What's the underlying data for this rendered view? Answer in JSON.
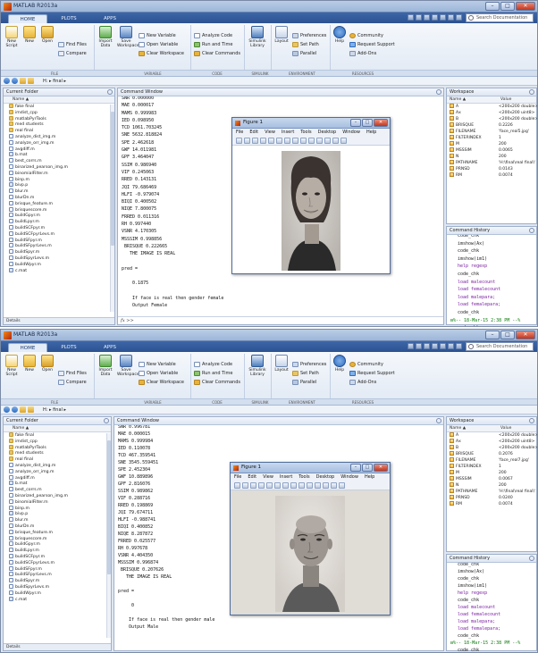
{
  "top": {
    "app_title": "MATLAB R2013a",
    "tabs": [
      "HOME",
      "PLOTS",
      "APPS"
    ],
    "search_placeholder": "Search Documentation",
    "ribbon": {
      "new_script": "New Script",
      "new": "New",
      "open": "Open",
      "find_files": "Find Files",
      "compare": "Compare",
      "import_data": "Import Data",
      "save_workspace": "Save Workspace",
      "new_variable": "New Variable",
      "open_variable": "Open Variable",
      "clear_workspace": "Clear Workspace",
      "analyze_code": "Analyze Code",
      "run_and_time": "Run and Time",
      "clear_commands": "Clear Commands",
      "simulink_library": "Simulink Library",
      "layout": "Layout",
      "preferences": "Preferences",
      "set_path": "Set Path",
      "parallel": "Parallel",
      "help": "Help",
      "community": "Community",
      "request_support": "Request Support",
      "add_ons": "Add-Ons",
      "groups": [
        "FILE",
        "VARIABLE",
        "CODE",
        "SIMULINK",
        "ENVIRONMENT",
        "RESOURCES"
      ]
    },
    "path": "H: ▸ final ▸",
    "current_folder_title": "Current Folder",
    "name_col": "Name ▲",
    "files": [
      {
        "name": "fake final",
        "type": "folder"
      },
      {
        "name": "imdist_cpp",
        "type": "folder"
      },
      {
        "name": "matlabPyrTools",
        "type": "folder"
      },
      {
        "name": "med students",
        "type": "folder"
      },
      {
        "name": "real final",
        "type": "folder"
      },
      {
        "name": "analyze_dist_img.m",
        "type": "m"
      },
      {
        "name": "analyze_orr_img.m",
        "type": "m"
      },
      {
        "name": "avgdiff.m",
        "type": "m"
      },
      {
        "name": "b.mat",
        "type": "c"
      },
      {
        "name": "best_corrs.m",
        "type": "m"
      },
      {
        "name": "binarized_pearson_img.m",
        "type": "m"
      },
      {
        "name": "binomialFilter.m",
        "type": "m"
      },
      {
        "name": "binp.m",
        "type": "m"
      },
      {
        "name": "bivp.p",
        "type": "c"
      },
      {
        "name": "blur.m",
        "type": "m"
      },
      {
        "name": "blurDn.m",
        "type": "m"
      },
      {
        "name": "brisque_feature.m",
        "type": "m"
      },
      {
        "name": "brisquescore.m",
        "type": "m"
      },
      {
        "name": "buildGpyr.m",
        "type": "m"
      },
      {
        "name": "buildLpyr.m",
        "type": "m"
      },
      {
        "name": "buildSCFpyr.m",
        "type": "m"
      },
      {
        "name": "buildSCFpyrLevs.m",
        "type": "m"
      },
      {
        "name": "buildSFpyr.m",
        "type": "m"
      },
      {
        "name": "buildSFpyrLevs.m",
        "type": "m"
      },
      {
        "name": "buildSpyr.m",
        "type": "m"
      },
      {
        "name": "buildSpyrLevs.m",
        "type": "m"
      },
      {
        "name": "buildWpyr.m",
        "type": "m"
      },
      {
        "name": "c.mat",
        "type": "c"
      }
    ],
    "details": "Details",
    "command_window_title": "Command Window",
    "command_lines": [
      "SNR 0.000000",
      "MAE 0.000017",
      "MAMS 0.999983",
      "IED 0.098950",
      "TCD 1061.703245",
      "SNE 5632.818824",
      "SPE 2.462618",
      "GWF 14.011981",
      "GPF 3.464047",
      "SSIM 0.986940",
      "VIF 0.245063",
      "RRED 0.143131",
      "JQI 79.686469",
      "HLFI -0.979074",
      "BIQI 0.400502",
      "NIQE 7.800075",
      "FRRED 0.011316",
      "RH 0.997440",
      "VSNR 4.170305",
      "MSSSIM 0.998856",
      " BRISQUE 0.222665",
      "   THE IMAGE IS REAL",
      "",
      "pred =",
      "",
      "    0.1875",
      "",
      "    If face is real then gender female",
      "    Output Female"
    ],
    "prompt": "fx >>",
    "figure_title": "Figure 1",
    "figure_menu": [
      "File",
      "Edit",
      "View",
      "Insert",
      "Tools",
      "Desktop",
      "Window",
      "Help"
    ],
    "workspace_title": "Workspace",
    "ws_cols": [
      "Name ▲",
      "Value"
    ],
    "workspace": [
      {
        "name": "A",
        "value": "<200x200 double>"
      },
      {
        "name": "Ax",
        "value": "<200x200 uint8>"
      },
      {
        "name": "B",
        "value": "<200x200 double>"
      },
      {
        "name": "BRISQUE",
        "value": "0.2226"
      },
      {
        "name": "FILENAME",
        "value": "'face_real5.jpg'"
      },
      {
        "name": "FILTERINDEX",
        "value": "1"
      },
      {
        "name": "M",
        "value": "200"
      },
      {
        "name": "MSSSIM",
        "value": "0.0065"
      },
      {
        "name": "N",
        "value": "200"
      },
      {
        "name": "PATHNAME",
        "value": "'H:\\final\\real final\\'"
      },
      {
        "name": "PRNSD",
        "value": "0.0143"
      },
      {
        "name": "RM",
        "value": "0.0074"
      }
    ],
    "history_title": "Command History",
    "history": [
      {
        "text": "code_chk",
        "kind": "cmd"
      },
      {
        "text": "imshow(Ax)",
        "kind": "cmd"
      },
      {
        "text": "code_chk",
        "kind": "cmd"
      },
      {
        "text": "imshow(im1)",
        "kind": "cmd"
      },
      {
        "text": "help regexp",
        "kind": "kw"
      },
      {
        "text": "code_chk",
        "kind": "cmd"
      },
      {
        "text": "load malecount",
        "kind": "kw"
      },
      {
        "text": "load femalecount",
        "kind": "kw"
      },
      {
        "text": "load malepara;",
        "kind": "kw"
      },
      {
        "text": "load femalepara;",
        "kind": "kw"
      },
      {
        "text": "code_chk",
        "kind": "cmd"
      },
      {
        "text": "⊟%-- 18-Mar-15 2:38 PM --%",
        "kind": "sep"
      },
      {
        "text": "code_chk",
        "kind": "cmd"
      }
    ]
  },
  "bottom": {
    "app_title": "MATLAB R2013a",
    "tabs": [
      "HOME",
      "PLOTS",
      "APPS"
    ],
    "search_placeholder": "Search Documentation",
    "path": "H: ▸ final ▸",
    "current_folder_title": "Current Folder",
    "name_col": "Name ▲",
    "files": [
      {
        "name": "fake final",
        "type": "folder"
      },
      {
        "name": "imdist_cpp",
        "type": "folder"
      },
      {
        "name": "matlabPyrTools",
        "type": "folder"
      },
      {
        "name": "med students",
        "type": "folder"
      },
      {
        "name": "real final",
        "type": "folder"
      },
      {
        "name": "analyze_dist_img.m",
        "type": "m"
      },
      {
        "name": "analyze_orr_img.m",
        "type": "m"
      },
      {
        "name": "avgdiff.m",
        "type": "m"
      },
      {
        "name": "b.mat",
        "type": "c"
      },
      {
        "name": "best_corrs.m",
        "type": "m"
      },
      {
        "name": "binarized_pearson_img.m",
        "type": "m"
      },
      {
        "name": "binomialFilter.m",
        "type": "m"
      },
      {
        "name": "binp.m",
        "type": "m"
      },
      {
        "name": "bivp.p",
        "type": "c"
      },
      {
        "name": "blur.m",
        "type": "m"
      },
      {
        "name": "blurDn.m",
        "type": "m"
      },
      {
        "name": "brisque_feature.m",
        "type": "m"
      },
      {
        "name": "brisquescore.m",
        "type": "m"
      },
      {
        "name": "buildGpyr.m",
        "type": "m"
      },
      {
        "name": "buildLpyr.m",
        "type": "m"
      },
      {
        "name": "buildSCFpyr.m",
        "type": "m"
      },
      {
        "name": "buildSCFpyrLevs.m",
        "type": "m"
      },
      {
        "name": "buildSFpyr.m",
        "type": "m"
      },
      {
        "name": "buildSFpyrLevs.m",
        "type": "m"
      },
      {
        "name": "buildSpyr.m",
        "type": "m"
      },
      {
        "name": "buildSpyrLevs.m",
        "type": "m"
      },
      {
        "name": "buildWpyr.m",
        "type": "m"
      },
      {
        "name": "c.mat",
        "type": "c"
      }
    ],
    "details": "Details",
    "command_window_title": "Command Window",
    "command_lines": [
      "SNR 0.996781",
      "MAE 0.000015",
      "MAMS 0.999984",
      "IED 0.110078",
      "TCD 467.359541",
      "SNE 3545.559451",
      "SPE 2.452304",
      "GWF 10.889896",
      "GPF 2.816076",
      "SSIM 0.989862",
      "VIF 0.288716",
      "RRED 0.198869",
      "JQI 79.674711",
      "HLFI -0.988741",
      "BIQI 0.400852",
      "NIQE 8.287872",
      "FRRED 0.025577",
      "RH 0.997678",
      "VSNR 4.404350",
      "MSSSIM 0.996874",
      " BRISQUE 0.207626",
      "   THE IMAGE IS REAL",
      "",
      "pred =",
      "",
      "     0",
      "",
      "    If face is real then gender male",
      "    Output Male"
    ],
    "figure_title": "Figure 1",
    "figure_menu": [
      "File",
      "Edit",
      "View",
      "Insert",
      "Tools",
      "Desktop",
      "Window",
      "Help"
    ],
    "workspace_title": "Workspace",
    "ws_cols": [
      "Name ▲",
      "Value"
    ],
    "workspace": [
      {
        "name": "A",
        "value": "<200x200 double>"
      },
      {
        "name": "Ax",
        "value": "<200x200 uint8>"
      },
      {
        "name": "B",
        "value": "<200x200 double>"
      },
      {
        "name": "BRISQUE",
        "value": "0.2076"
      },
      {
        "name": "FILENAME",
        "value": "'face_real7.jpg'"
      },
      {
        "name": "FILTERINDEX",
        "value": "1"
      },
      {
        "name": "M",
        "value": "200"
      },
      {
        "name": "MSSSIM",
        "value": "0.0067"
      },
      {
        "name": "N",
        "value": "200"
      },
      {
        "name": "PATHNAME",
        "value": "'H:\\final\\real final\\'"
      },
      {
        "name": "PRNSD",
        "value": "0.0240"
      },
      {
        "name": "RM",
        "value": "0.0074"
      }
    ],
    "history_title": "Command History",
    "history": [
      {
        "text": "code_chk",
        "kind": "cmd"
      },
      {
        "text": "imshow(Ax)",
        "kind": "cmd"
      },
      {
        "text": "code_chk",
        "kind": "cmd"
      },
      {
        "text": "imshow(im1)",
        "kind": "cmd"
      },
      {
        "text": "help regexp",
        "kind": "kw"
      },
      {
        "text": "code_chk",
        "kind": "cmd"
      },
      {
        "text": "load malecount",
        "kind": "kw"
      },
      {
        "text": "load femalecount",
        "kind": "kw"
      },
      {
        "text": "load malepara;",
        "kind": "kw"
      },
      {
        "text": "load femalepara;",
        "kind": "kw"
      },
      {
        "text": "code_chk",
        "kind": "cmd"
      },
      {
        "text": "⊟%-- 18-Mar-15 2:38 PM --%",
        "kind": "sep"
      },
      {
        "text": "code_chk",
        "kind": "cmd"
      }
    ]
  },
  "colors": {
    "tab_bar": "#2c5190",
    "figure_face": "#e0dcd6",
    "matlab_logo": "#f28a1a"
  }
}
